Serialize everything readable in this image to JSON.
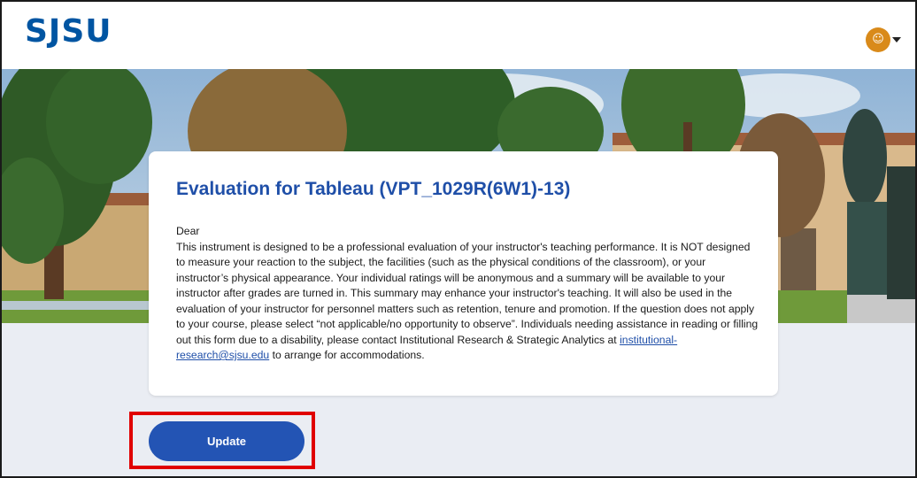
{
  "header": {
    "logo_text": "SJSU",
    "avatar_icon": "user-avatar-icon",
    "avatar_color": "#d98a1a"
  },
  "banner": {
    "image_description_icon": "campus-banner-image"
  },
  "card": {
    "title": "Evaluation for Tableau (VPT_1029R(6W1)-13)",
    "greeting": "Dear",
    "body_before_email": "This instrument is designed to be a professional evaluation of your instructor's teaching performance. It is NOT designed to measure your reaction to the subject, the facilities (such as the physical conditions of the classroom), or your instructor’s physical appearance. Your individual ratings will be anonymous and a summary will be available to your instructor after grades are turned in. This summary may enhance your instructor's teaching. It will also be used in the evaluation of your instructor for personnel matters such as retention, tenure and promotion. If the question does not apply to your course, please select “not applicable/no opportunity to observe”. Individuals needing assistance in reading or filling out this form due to a disability, please contact Institutional Research & Strategic Analytics at ",
    "email": "institutional-research@sjsu.edu",
    "body_after_email": " to arrange for accommodations."
  },
  "actions": {
    "update_label": "Update"
  },
  "colors": {
    "brand_blue": "#0055a2",
    "title_blue": "#1f4fa8",
    "button_blue": "#2354b4",
    "highlight_red": "#e00000",
    "page_bg": "#eaedf3"
  }
}
